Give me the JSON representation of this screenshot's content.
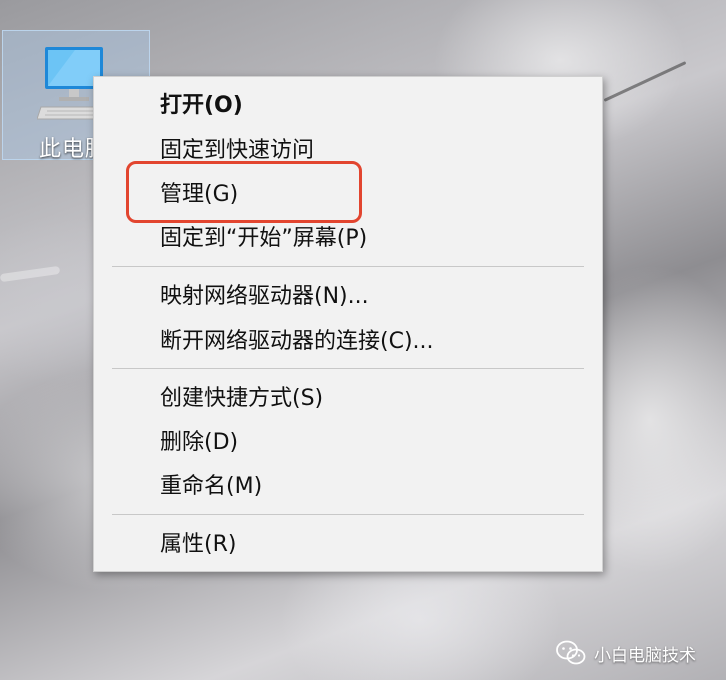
{
  "desktop": {
    "icon_label": "此电脑"
  },
  "context_menu": {
    "items": [
      {
        "label": "打开(O)"
      },
      {
        "label": "固定到快速访问"
      },
      {
        "label": "管理(G)"
      },
      {
        "label": "固定到“开始”屏幕(P)"
      },
      {
        "label": "映射网络驱动器(N)..."
      },
      {
        "label": "断开网络驱动器的连接(C)..."
      },
      {
        "label": "创建快捷方式(S)"
      },
      {
        "label": "删除(D)"
      },
      {
        "label": "重命名(M)"
      },
      {
        "label": "属性(R)"
      }
    ]
  },
  "annotation": {
    "highlight_color": "#e2452f"
  },
  "watermark": {
    "text": "小白电脑技术",
    "icon": "wechat-icon"
  }
}
